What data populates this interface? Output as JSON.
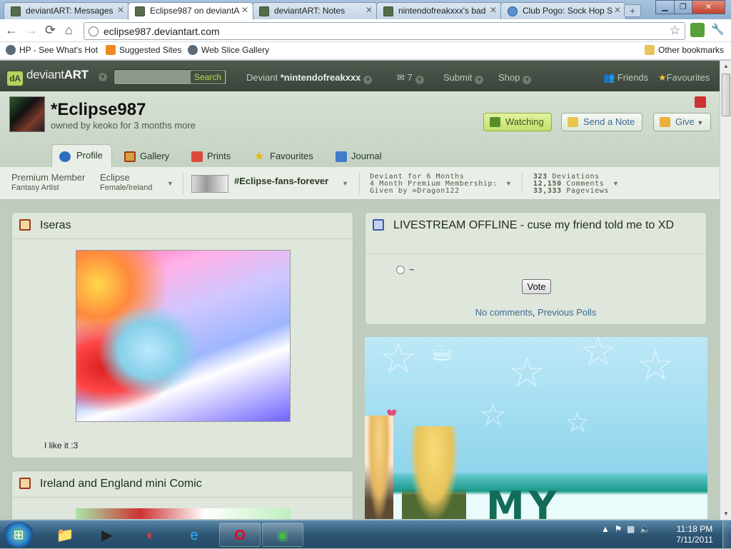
{
  "browser": {
    "tabs": [
      {
        "title": "deviantART: Messages"
      },
      {
        "title": "Eclipse987 on deviantA"
      },
      {
        "title": "deviantART: Notes"
      },
      {
        "title": "nintendofreakxxx's bad"
      },
      {
        "title": "Club Pogo: Sock Hop S"
      }
    ],
    "url": "eclipse987.deviantart.com",
    "bookmarks": [
      "HP - See What's Hot",
      "Suggested Sites",
      "Web Slice Gallery"
    ],
    "other_bookmarks": "Other bookmarks",
    "icons": {
      "back": "←",
      "forward": "→",
      "reload": "⟳",
      "home": "⌂",
      "star": "☆",
      "wrench": "🔧"
    }
  },
  "da_header": {
    "logo_prefix": "deviant",
    "logo_suffix": "ART",
    "search_button": "Search",
    "deviant_label": "Deviant",
    "deviant_name": "*nintendofreakxxx",
    "notes_count": "7",
    "submit": "Submit",
    "shop": "Shop",
    "friends": "Friends",
    "favourites": "Favourites"
  },
  "profile": {
    "username": "*Eclipse987",
    "owned_text": "owned by keoko for 3 months more",
    "buttons": {
      "watching": "Watching",
      "send_note": "Send a Note",
      "give": "Give"
    },
    "tabs": [
      "Profile",
      "Gallery",
      "Prints",
      "Favourites",
      "Journal"
    ],
    "active_tab": "Profile"
  },
  "stats": {
    "membership": "Premium Member",
    "artist_type": "Fantasy Artist",
    "name": "Eclipse",
    "gender_country": "Female/Ireland",
    "group": "#Eclipse-fans-forever",
    "deviant_for": "Deviant for 6 Months",
    "premium_membership": "4 Month Premium Membership:",
    "given_by": "Given by =Dragon122",
    "deviations": "323",
    "deviations_label": "Deviations",
    "comments": "12,150",
    "comments_label": "Comments",
    "pageviews": "33,333",
    "pageviews_label": "Pageviews"
  },
  "widgets": {
    "featured_title": "Iseras",
    "featured_caption": "I like it :3",
    "comic_title": "Ireland and England mini Comic",
    "poll_title": "LIVESTREAM OFFLINE - cuse my friend told me to XD",
    "poll_option": "~",
    "vote_button": "Vote",
    "poll_links_a": "No comments",
    "poll_links_sep": ", ",
    "poll_links_b": "Previous Polls",
    "journal_banner_text": "MY JOURNA"
  },
  "taskbar": {
    "time": "11:18 PM",
    "date": "7/11/2011"
  }
}
